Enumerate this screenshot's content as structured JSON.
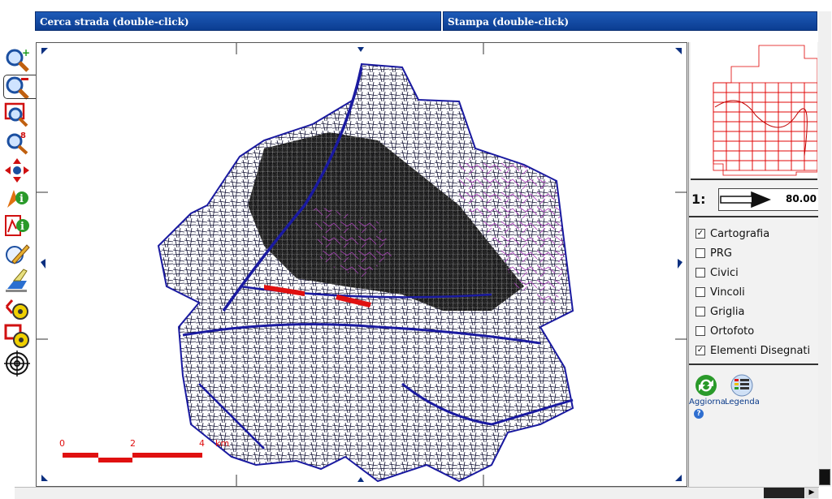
{
  "header": {
    "search_title": "Cerca strada (double-click)",
    "print_title": "Stampa (double-click)"
  },
  "toolbar": {
    "tools": [
      {
        "name": "zoom-in-icon"
      },
      {
        "name": "zoom-out-icon"
      },
      {
        "name": "zoom-rectangle-icon"
      },
      {
        "name": "zoom-scale-icon"
      },
      {
        "name": "pan-icon"
      },
      {
        "name": "identify-icon"
      },
      {
        "name": "info-map-icon"
      },
      {
        "name": "draw-pencil-icon"
      },
      {
        "name": "erase-icon"
      },
      {
        "name": "measure-distance-icon"
      },
      {
        "name": "measure-area-icon"
      },
      {
        "name": "target-icon"
      }
    ]
  },
  "map": {
    "scalebar": {
      "labels": [
        "0",
        "2",
        "4"
      ],
      "unit": "km"
    },
    "colors": {
      "roads": "#000000",
      "highways": "#1a1aa0",
      "hydro": "#b040c0",
      "highlight": "#e01010"
    }
  },
  "scale": {
    "prefix": "1:",
    "value": "80.00"
  },
  "layers": [
    {
      "label": "Cartografia",
      "checked": true
    },
    {
      "label": "PRG",
      "checked": false
    },
    {
      "label": "Civici",
      "checked": false
    },
    {
      "label": "Vincoli",
      "checked": false
    },
    {
      "label": "Griglia",
      "checked": false
    },
    {
      "label": "Ortofoto",
      "checked": false
    },
    {
      "label": "Elementi Disegnati",
      "checked": true
    }
  ],
  "actions": {
    "refresh": "Aggiorna",
    "legend": "Legenda",
    "help": "?"
  },
  "colors": {
    "header": "#0b3d91",
    "overview_grid": "#e00000"
  }
}
